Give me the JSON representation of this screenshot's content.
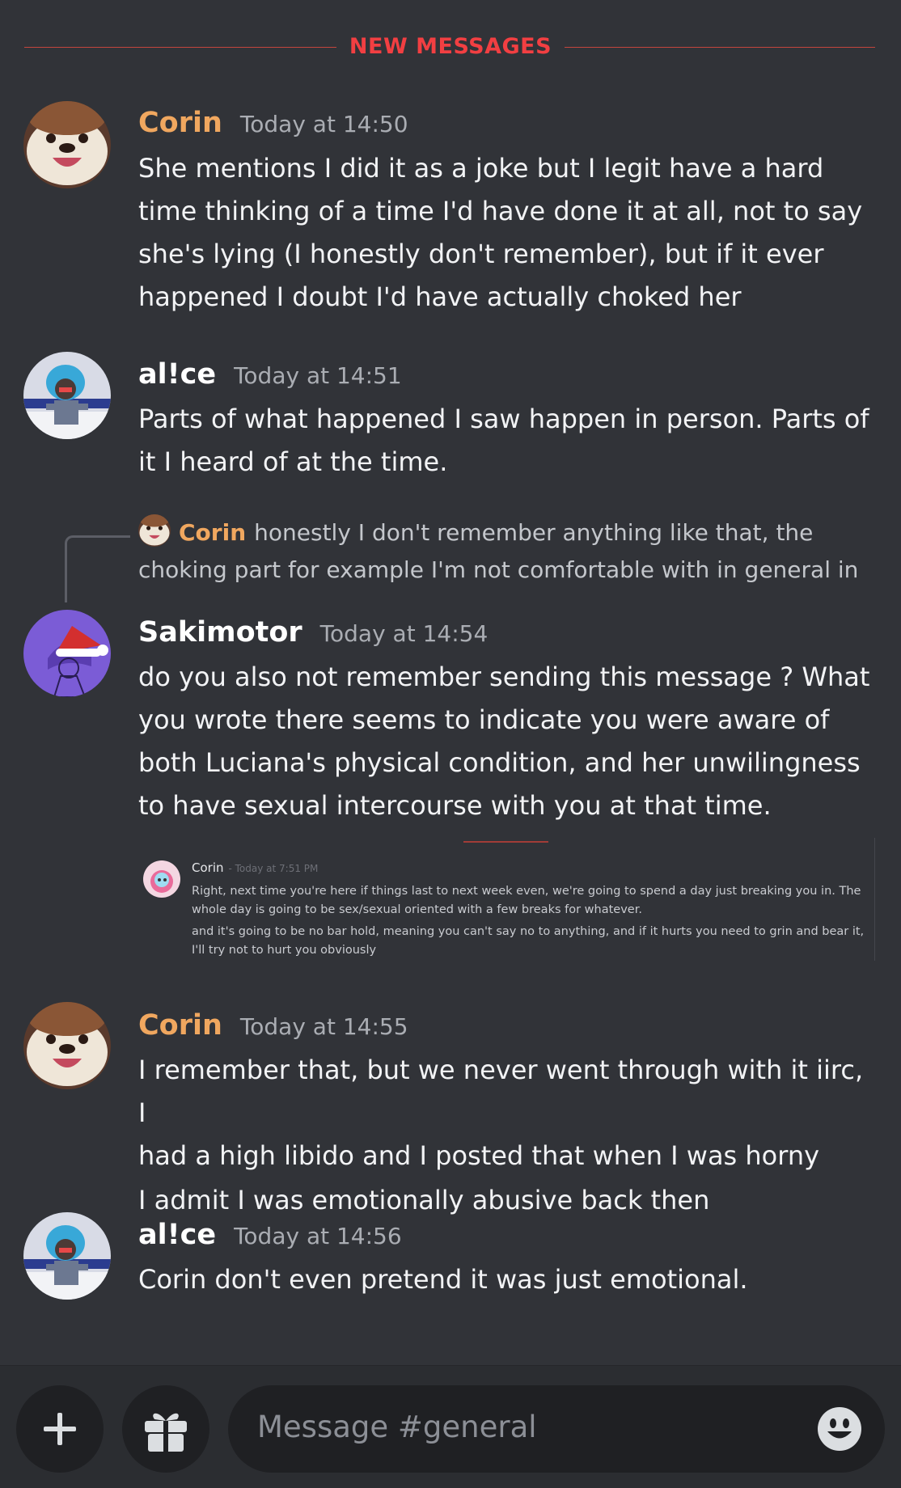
{
  "divider": {
    "label": "NEW MESSAGES"
  },
  "colors": {
    "background": "#313338",
    "new_messages": "#f23f42",
    "corin": "#f0a75f",
    "timestamp": "#aaadb3"
  },
  "messages": [
    {
      "author": "Corin",
      "author_color": "#f0a75f",
      "time": "Today at 14:50",
      "lines": [
        "She mentions I did it as a joke but I legit have a hard",
        "time thinking of a time I'd have done it at all, not to say",
        "she's lying (I honestly don't remember), but if it ever",
        "happened I doubt I'd have actually choked her"
      ]
    },
    {
      "author": "al!ce",
      "author_color": "#ffffff",
      "time": "Today at 14:51",
      "lines": [
        "Parts of what happened I saw happen in person. Parts of",
        "it I heard of at the time."
      ]
    },
    {
      "author": "Sakimotor",
      "author_color": "#ffffff",
      "time": "Today at 14:54",
      "reply": {
        "author": "Corin",
        "lines": [
          "honestly I don't remember anything like that, the",
          "choking part for example I'm not comfortable with in general in"
        ]
      },
      "lines": [
        "do you also not remember sending this message ? What",
        "you wrote there seems to indicate you were aware of",
        "both Luciana's physical condition, and her unwilingness",
        "to have sexual intercourse with you at that time."
      ],
      "attachment": {
        "author": "Corin",
        "time": "- Today at 7:51 PM",
        "lines": [
          "Right, next time you're here if things last to next week even, we're going to spend a day just breaking you in. The",
          "whole day is going to be sex/sexual oriented with a few breaks for whatever.",
          "and it's going to be no bar hold, meaning you can't say no to anything, and if it hurts you need to grin and bear it,",
          "I'll try not to hurt you obviously"
        ]
      }
    },
    {
      "author": "Corin",
      "author_color": "#f0a75f",
      "time": "Today at 14:55",
      "lines": [
        "I remember that, but we never went through with it iirc, I",
        "had a high libido and I posted that when I was horny",
        "I admit I was emotionally abusive back then"
      ]
    },
    {
      "author": "al!ce",
      "author_color": "#ffffff",
      "time": "Today at 14:56",
      "lines": [
        "Corin don't even pretend it was just emotional."
      ]
    }
  ],
  "composer": {
    "placeholder": "Message #general",
    "icons": [
      "plus-icon",
      "gift-icon",
      "emoji-icon"
    ]
  }
}
